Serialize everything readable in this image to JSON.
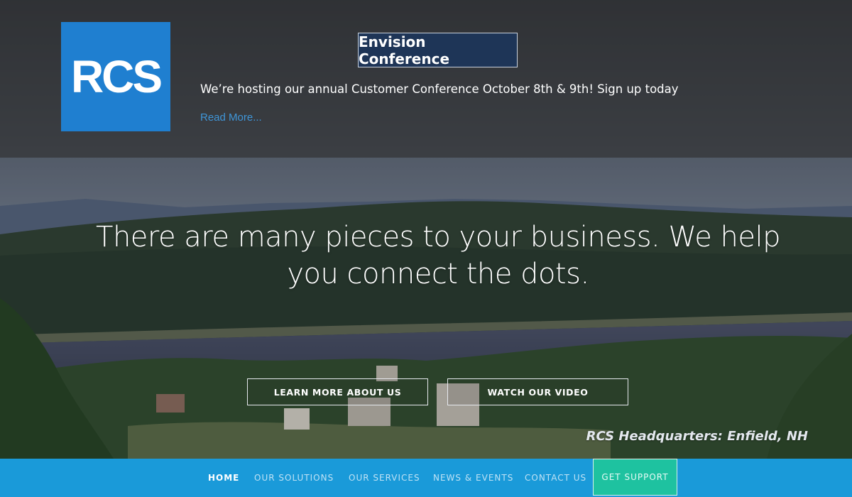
{
  "announcement": {
    "logo_text": "RCS",
    "title": "Envision Conference",
    "text": "We’re hosting our annual Customer Conference October 8th & 9th! Sign up today",
    "read_more": "Read More..."
  },
  "hero": {
    "headline": "There are many pieces to your business. We help you connect the dots.",
    "buttons": {
      "learn_more": "LEARN MORE ABOUT US",
      "watch_video": "WATCH OUR VIDEO"
    },
    "caption": "RCS Headquarters: Enfield, NH"
  },
  "nav": {
    "items": [
      "HOME",
      "OUR SOLUTIONS",
      "OUR SERVICES",
      "NEWS & EVENTS",
      "CONTACT US"
    ],
    "active": "HOME",
    "support": "GET SUPPORT"
  },
  "colors": {
    "brand_blue": "#1f7fd0",
    "nav_blue": "#1a9ad9",
    "support_green": "#1ec2a0",
    "conference_navy": "#1e3557"
  }
}
